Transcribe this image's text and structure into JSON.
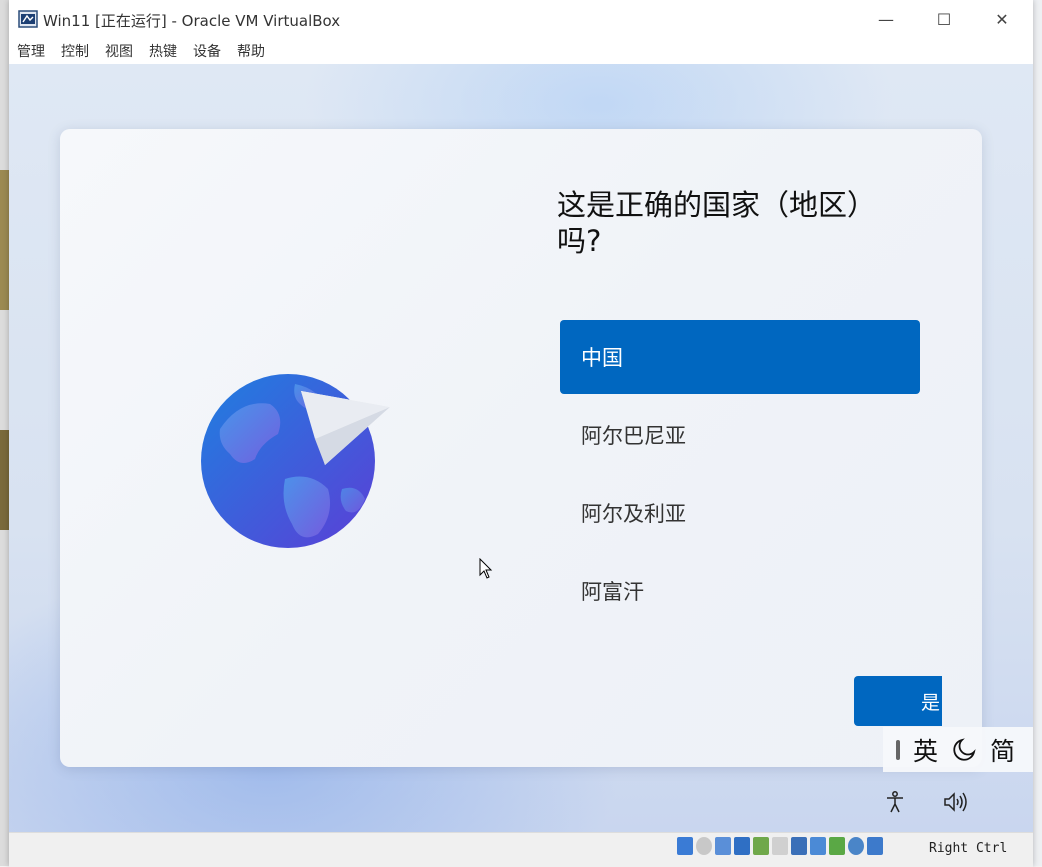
{
  "window": {
    "title": "Win11 [正在运行] - Oracle VM VirtualBox",
    "minimize_glyph": "—",
    "maximize_glyph": "☐",
    "close_glyph": "✕"
  },
  "menubar": {
    "items": [
      "管理",
      "控制",
      "视图",
      "热键",
      "设备",
      "帮助"
    ]
  },
  "oobe": {
    "heading": "这是正确的国家（地区）吗?",
    "countries": [
      {
        "label": "中国",
        "selected": true
      },
      {
        "label": "阿尔巴尼亚",
        "selected": false
      },
      {
        "label": "阿尔及利亚",
        "selected": false
      },
      {
        "label": "阿富汗",
        "selected": false
      }
    ],
    "yes_button": "是",
    "accent_color": "#0067c0"
  },
  "ime": {
    "language": "英",
    "charset": "简"
  },
  "statusbar": {
    "host_key": "Right Ctrl"
  },
  "icons": [
    "virtualbox-icon",
    "globe-icon",
    "paper-plane-icon",
    "moon-icon",
    "accessibility-icon",
    "volume-icon",
    "mouse-cursor-icon"
  ]
}
